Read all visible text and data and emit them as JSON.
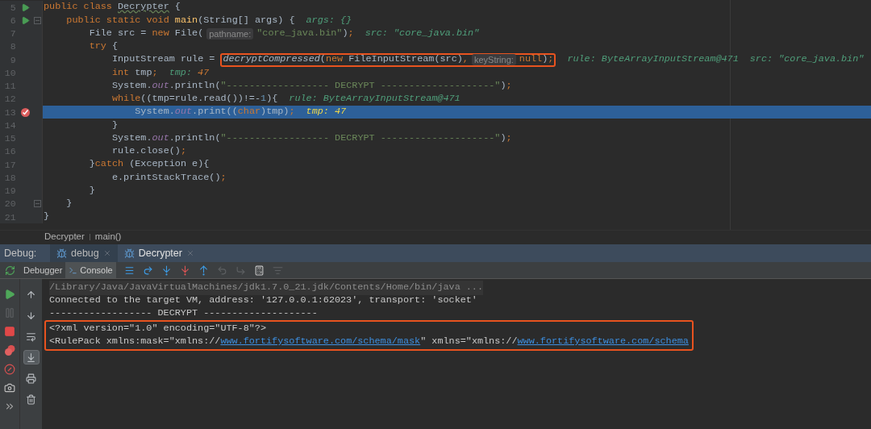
{
  "editor": {
    "lines": [
      {
        "number": "5",
        "run": true,
        "breakpoint": false,
        "fold": false,
        "selected": false,
        "tokens": [
          {
            "kind": "keyword",
            "text": "public class "
          },
          {
            "kind": "warning",
            "text": "Decrypter"
          },
          {
            "kind": "plain",
            "text": " {"
          }
        ]
      },
      {
        "number": "6",
        "run": true,
        "breakpoint": false,
        "fold": true,
        "selected": false,
        "tokens": [
          {
            "kind": "keyword",
            "text": "    public static void "
          },
          {
            "kind": "method",
            "text": "main"
          },
          {
            "kind": "plain",
            "text": "(String[] args) {"
          },
          {
            "kind": "debug_name",
            "text": "args:"
          },
          {
            "kind": "debug_value",
            "text": "{}"
          }
        ]
      },
      {
        "number": "7",
        "run": false,
        "breakpoint": false,
        "fold": false,
        "selected": false,
        "tokens": [
          {
            "kind": "plain",
            "text": "        File src = "
          },
          {
            "kind": "keyword",
            "text": "new"
          },
          {
            "kind": "plain",
            "text": " File("
          },
          {
            "kind": "hint",
            "text": "pathname:"
          },
          {
            "kind": "string",
            "text": "\"core_java.bin\""
          },
          {
            "kind": "plain",
            "text": ")"
          },
          {
            "kind": "keyword",
            "text": ";"
          },
          {
            "kind": "debug_name",
            "text": "src:"
          },
          {
            "kind": "debug_value",
            "text": "\"core_java.bin\""
          }
        ]
      },
      {
        "number": "8",
        "run": false,
        "breakpoint": false,
        "fold": false,
        "selected": false,
        "tokens": [
          {
            "kind": "keyword",
            "text": "        try"
          },
          {
            "kind": "plain",
            "text": " {"
          }
        ]
      },
      {
        "number": "9",
        "run": false,
        "breakpoint": false,
        "fold": false,
        "selected": false,
        "tokens": [
          {
            "kind": "plain",
            "text": "            InputStream rule = "
          },
          {
            "kind": "frame",
            "tokens": [
              {
                "kind": "italic",
                "text": "decryptCompressed"
              },
              {
                "kind": "plain",
                "text": "("
              },
              {
                "kind": "keyword",
                "text": "new"
              },
              {
                "kind": "plain",
                "text": " FileInputStream(src)"
              },
              {
                "kind": "keyword",
                "text": ","
              },
              {
                "kind": "hint",
                "text": "keyString:"
              },
              {
                "kind": "keyword",
                "text": "null"
              },
              {
                "kind": "plain",
                "text": ")"
              },
              {
                "kind": "keyword",
                "text": ";"
              }
            ]
          },
          {
            "kind": "debug_name",
            "text": "rule:"
          },
          {
            "kind": "debug_value",
            "text": "ByteArrayInputStream@471"
          },
          {
            "kind": "debug_name",
            "text": "src:"
          },
          {
            "kind": "debug_value",
            "text": "\"core_java.bin\""
          }
        ]
      },
      {
        "number": "10",
        "run": false,
        "breakpoint": false,
        "fold": false,
        "selected": false,
        "tokens": [
          {
            "kind": "keyword",
            "text": "            int"
          },
          {
            "kind": "plain",
            "text": " tmp"
          },
          {
            "kind": "keyword",
            "text": ";"
          },
          {
            "kind": "debug_name",
            "text": "tmp:"
          },
          {
            "kind": "debug_number",
            "text": "47"
          }
        ]
      },
      {
        "number": "11",
        "run": false,
        "breakpoint": false,
        "fold": false,
        "selected": false,
        "tokens": [
          {
            "kind": "plain",
            "text": "            System."
          },
          {
            "kind": "field",
            "text": "out"
          },
          {
            "kind": "plain",
            "text": ".println("
          },
          {
            "kind": "string",
            "text": "\"------------------ DECRYPT --------------------\""
          },
          {
            "kind": "plain",
            "text": ")"
          },
          {
            "kind": "keyword",
            "text": ";"
          }
        ]
      },
      {
        "number": "12",
        "run": false,
        "breakpoint": false,
        "fold": false,
        "selected": false,
        "tokens": [
          {
            "kind": "keyword",
            "text": "            while"
          },
          {
            "kind": "plain",
            "text": "((tmp=rule.read())!=-"
          },
          {
            "kind": "number",
            "text": "1"
          },
          {
            "kind": "plain",
            "text": "){"
          },
          {
            "kind": "debug_name",
            "text": "rule:"
          },
          {
            "kind": "debug_value",
            "text": "ByteArrayInputStream@471"
          }
        ]
      },
      {
        "number": "13",
        "run": false,
        "breakpoint": true,
        "fold": false,
        "selected": true,
        "tokens": [
          {
            "kind": "plain",
            "text": "                System."
          },
          {
            "kind": "field",
            "text": "out"
          },
          {
            "kind": "plain",
            "text": ".print(("
          },
          {
            "kind": "keyword",
            "text": "char"
          },
          {
            "kind": "plain",
            "text": ")tmp)"
          },
          {
            "kind": "keyword",
            "text": ";"
          },
          {
            "kind": "debug_name",
            "text": "tmp:"
          },
          {
            "kind": "debug_number",
            "text": "47"
          }
        ]
      },
      {
        "number": "14",
        "run": false,
        "breakpoint": false,
        "fold": false,
        "selected": false,
        "tokens": [
          {
            "kind": "plain",
            "text": "            }"
          }
        ]
      },
      {
        "number": "15",
        "run": false,
        "breakpoint": false,
        "fold": false,
        "selected": false,
        "tokens": [
          {
            "kind": "plain",
            "text": "            System."
          },
          {
            "kind": "field",
            "text": "out"
          },
          {
            "kind": "plain",
            "text": ".println("
          },
          {
            "kind": "string",
            "text": "\"------------------ DECRYPT --------------------\""
          },
          {
            "kind": "plain",
            "text": ")"
          },
          {
            "kind": "keyword",
            "text": ";"
          }
        ]
      },
      {
        "number": "16",
        "run": false,
        "breakpoint": false,
        "fold": false,
        "selected": false,
        "tokens": [
          {
            "kind": "plain",
            "text": "            rule.close()"
          },
          {
            "kind": "keyword",
            "text": ";"
          }
        ]
      },
      {
        "number": "17",
        "run": false,
        "breakpoint": false,
        "fold": false,
        "selected": false,
        "tokens": [
          {
            "kind": "plain",
            "text": "        }"
          },
          {
            "kind": "keyword",
            "text": "catch"
          },
          {
            "kind": "plain",
            "text": " (Exception e){"
          }
        ]
      },
      {
        "number": "18",
        "run": false,
        "breakpoint": false,
        "fold": false,
        "selected": false,
        "tokens": [
          {
            "kind": "plain",
            "text": "            e.printStackTrace()"
          },
          {
            "kind": "keyword",
            "text": ";"
          }
        ]
      },
      {
        "number": "19",
        "run": false,
        "breakpoint": false,
        "fold": false,
        "selected": false,
        "tokens": [
          {
            "kind": "plain",
            "text": "        }"
          }
        ]
      },
      {
        "number": "20",
        "run": false,
        "breakpoint": false,
        "fold": true,
        "selected": false,
        "tokens": [
          {
            "kind": "plain",
            "text": "    }"
          }
        ]
      },
      {
        "number": "21",
        "run": false,
        "breakpoint": false,
        "fold": false,
        "selected": false,
        "tokens": [
          {
            "kind": "plain",
            "text": "}"
          }
        ]
      }
    ]
  },
  "breadcrumbs": [
    "Decrypter",
    "main()"
  ],
  "debug_panel": {
    "label": "Debug:",
    "tabs": [
      {
        "label": "debug",
        "selected": false
      },
      {
        "label": "Decrypter",
        "selected": true
      }
    ],
    "subtabs": [
      {
        "label": "Debugger",
        "selected": false
      },
      {
        "label": "Console",
        "selected": true
      }
    ],
    "toolbar_actions": [
      {
        "kind": "frames",
        "disabled": false
      },
      {
        "kind": "step_over",
        "disabled": false
      },
      {
        "kind": "step_into",
        "disabled": false
      },
      {
        "kind": "force_step_into",
        "disabled": false
      },
      {
        "kind": "step_out",
        "disabled": false
      },
      {
        "kind": "drop_frame",
        "disabled": true
      },
      {
        "kind": "run_to_cursor",
        "disabled": true
      },
      {
        "kind": "evaluate",
        "disabled": false
      },
      {
        "kind": "trace",
        "disabled": true
      }
    ],
    "side_actions": [
      {
        "kind": "resume",
        "disabled": false
      },
      {
        "kind": "pause",
        "disabled": true
      },
      {
        "kind": "stop",
        "disabled": false
      },
      {
        "kind": "breakpoints",
        "disabled": false
      },
      {
        "kind": "mute",
        "disabled": false
      },
      {
        "kind": "camera",
        "disabled": false
      },
      {
        "kind": "more",
        "disabled": false
      }
    ],
    "console_actions": [
      {
        "kind": "up",
        "selected": false
      },
      {
        "kind": "down",
        "selected": false
      },
      {
        "kind": "wrap",
        "selected": false
      },
      {
        "kind": "scroll_end",
        "selected": true
      },
      {
        "kind": "print",
        "selected": false
      },
      {
        "kind": "clear",
        "selected": false
      }
    ],
    "console": {
      "lines": [
        {
          "kind": "command",
          "highlighted": false,
          "segments": [
            {
              "text": "/Library/Java/JavaVirtualMachines/jdk1.7.0_21.jdk/Contents/Home/bin/java ...",
              "link": false
            }
          ]
        },
        {
          "kind": "output",
          "highlighted": false,
          "segments": [
            {
              "text": "Connected to the target VM, address: '127.0.0.1:62023', transport: 'socket'",
              "link": false
            }
          ]
        },
        {
          "kind": "output",
          "highlighted": false,
          "segments": [
            {
              "text": "------------------ DECRYPT --------------------",
              "link": false
            }
          ]
        },
        {
          "kind": "output",
          "highlighted": true,
          "segments": [
            {
              "text": "<?xml version=\"1.0\" encoding=\"UTF-8\"?>",
              "link": false
            }
          ]
        },
        {
          "kind": "output",
          "highlighted": true,
          "segments": [
            {
              "text": "<RulePack xmlns:mask=\"xmlns://",
              "link": false
            },
            {
              "text": "www.fortifysoftware.com/schema/mask",
              "link": true
            },
            {
              "text": "\" xmlns=\"xmlns://",
              "link": false
            },
            {
              "text": "www.fortifysoftware.com/schema",
              "link": true
            }
          ]
        }
      ]
    }
  }
}
